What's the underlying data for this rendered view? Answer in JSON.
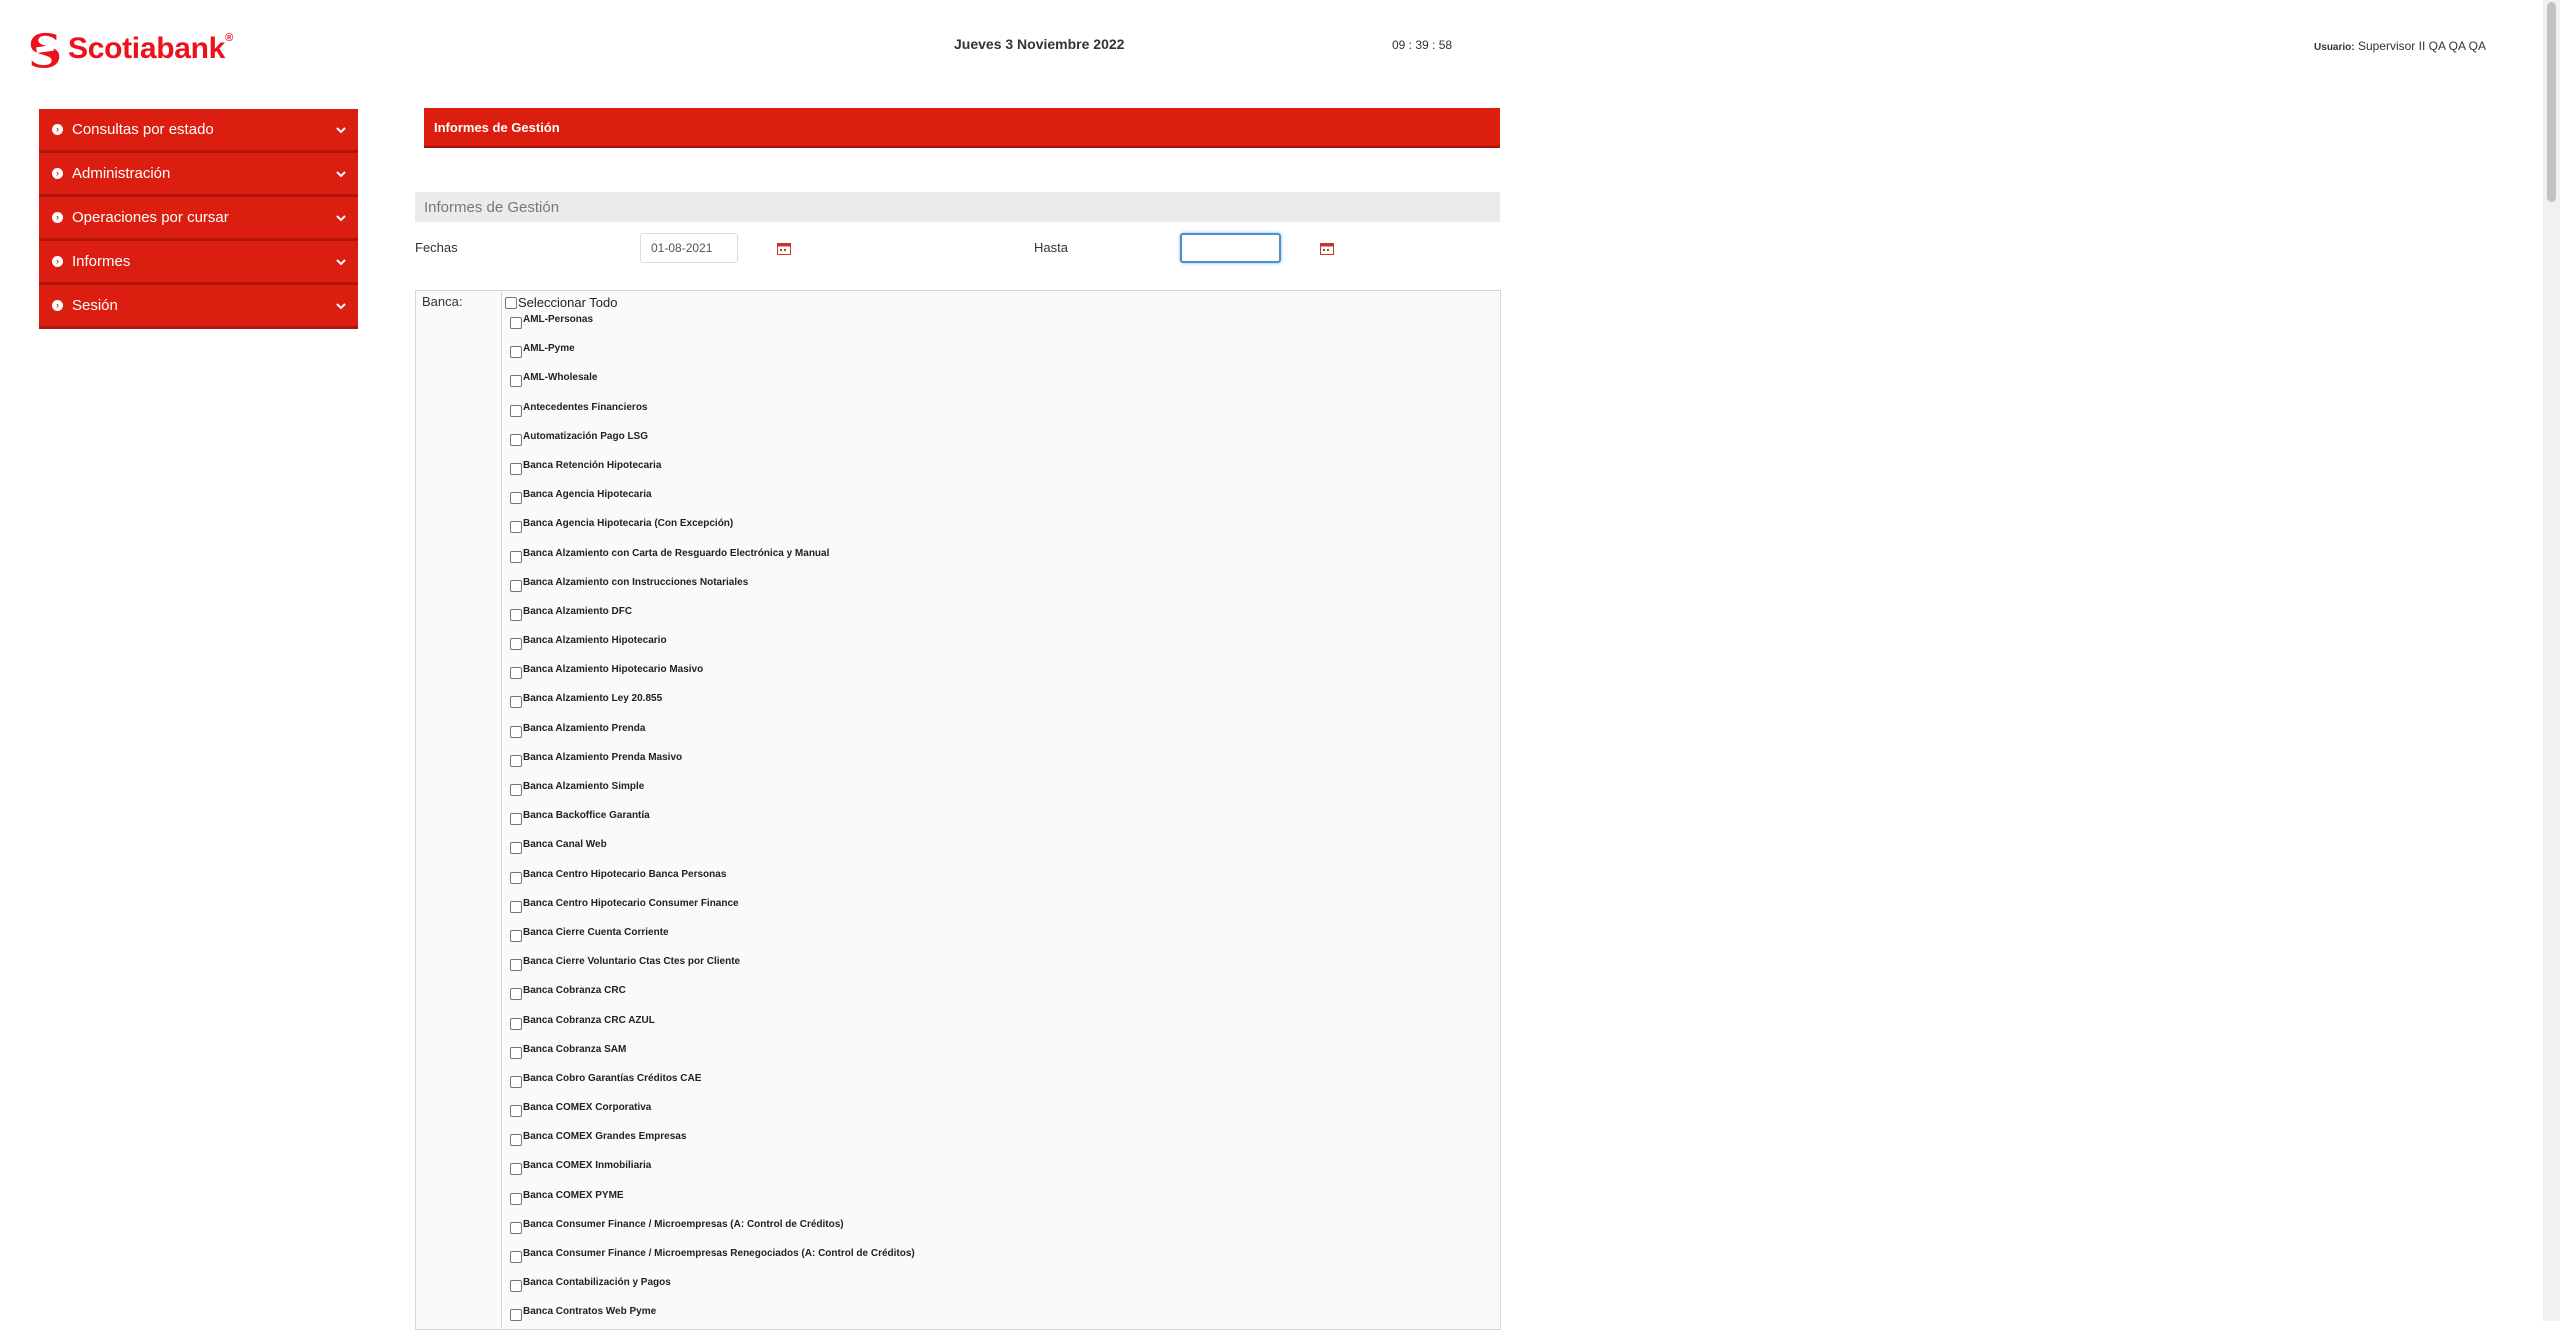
{
  "brand": {
    "name": "Scotiabank",
    "reg": "®",
    "color": "#ec111a"
  },
  "header": {
    "date": "Jueves 3 Noviembre 2022",
    "time": "09 : 39 : 58",
    "user_label": "Usuario:",
    "user_name": "Supervisor II QA QA QA"
  },
  "sidebar": {
    "items": [
      {
        "label": "Consultas por estado",
        "icon": "chevron-down-icon"
      },
      {
        "label": "Administración",
        "icon": "chevron-down-icon"
      },
      {
        "label": "Operaciones por cursar",
        "icon": "chevron-down-icon"
      },
      {
        "label": "Informes",
        "icon": "chevron-down-icon"
      },
      {
        "label": "Sesión",
        "icon": "chevron-down-icon"
      }
    ]
  },
  "main": {
    "banner_title": "Informes de Gestión",
    "section_title": "Informes de Gestión",
    "fechas_label": "Fechas",
    "fecha_desde": "01-08-2021",
    "hasta_label": "Hasta",
    "fecha_hasta": "",
    "banca_label": "Banca:",
    "select_all_label": "Seleccionar Todo",
    "banca_options": [
      "AML-Personas",
      "AML-Pyme",
      "AML-Wholesale",
      "Antecedentes Financieros",
      "Automatización Pago LSG",
      "Banca Retención Hipotecaria",
      "Banca Agencia Hipotecaria",
      "Banca Agencia Hipotecaria (Con Excepción)",
      "Banca Alzamiento con Carta de Resguardo Electrónica y Manual",
      "Banca Alzamiento con Instrucciones Notariales",
      "Banca Alzamiento DFC",
      "Banca Alzamiento Hipotecario",
      "Banca Alzamiento Hipotecario Masivo",
      "Banca Alzamiento Ley 20.855",
      "Banca Alzamiento Prenda",
      "Banca Alzamiento Prenda Masivo",
      "Banca Alzamiento Simple",
      "Banca Backoffice Garantía",
      "Banca Canal Web",
      "Banca Centro Hipotecario Banca Personas",
      "Banca Centro Hipotecario Consumer Finance",
      "Banca Cierre Cuenta Corriente",
      "Banca Cierre Voluntario Ctas Ctes por Cliente",
      "Banca Cobranza CRC",
      "Banca Cobranza CRC AZUL",
      "Banca Cobranza SAM",
      "Banca Cobro Garantías Créditos CAE",
      "Banca COMEX Corporativa",
      "Banca COMEX Grandes Empresas",
      "Banca COMEX Inmobiliaria",
      "Banca COMEX PYME",
      "Banca Consumer Finance / Microempresas (A: Control de Créditos)",
      "Banca Consumer Finance / Microempresas Renegociados (A: Control de Créditos)",
      "Banca Contabilización y Pagos",
      "Banca Contratos Web Pyme"
    ]
  }
}
